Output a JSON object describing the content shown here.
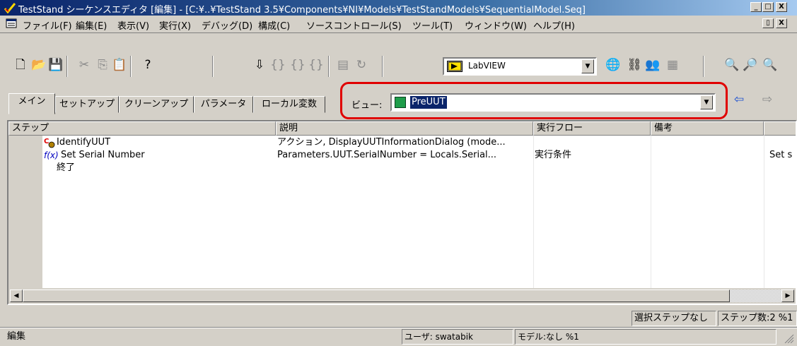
{
  "window": {
    "title": "TestStand シーケンスエディタ [編集] - [C:¥..¥TestStand 3.5¥Components¥NI¥Models¥TestStandModels¥SequentialModel.Seq]",
    "minimize": "_",
    "maximize": "□",
    "close": "X",
    "child_restore": "▯",
    "child_close": "X"
  },
  "menu": {
    "items": [
      "ファイル(F)",
      "編集(E)",
      "表示(V)",
      "実行(X)",
      "デバッグ(D)",
      "構成(C)",
      "ソースコントロール(S)",
      "ツール(T)",
      "ウィンドウ(W)",
      "ヘルプ(H)"
    ]
  },
  "toolbar": {
    "adapter_label": "LabVIEW",
    "adapter_dropdown": "▼"
  },
  "tabs": {
    "items": [
      "メイン",
      "セットアップ",
      "クリーンアップ",
      "パラメータ",
      "ローカル変数"
    ]
  },
  "view": {
    "label": "ビュー:",
    "value": "PreUUT",
    "dropdown": "▼"
  },
  "grid": {
    "columns": [
      "ステップ",
      "説明",
      "実行フロー",
      "備考"
    ],
    "rows": [
      {
        "step": "IdentifyUUT",
        "description": "アクション, DisplayUUTInformationDialog (mode...",
        "flow": "",
        "note": "",
        "extra": ""
      },
      {
        "step": "Set Serial Number",
        "description": "Parameters.UUT.SerialNumber = Locals.Serial...",
        "flow": "実行条件",
        "note": "",
        "extra": "Set s"
      },
      {
        "step": "終了",
        "description": "",
        "flow": "",
        "note": "",
        "extra": ""
      }
    ],
    "scroll_left": "◀",
    "scroll_right": "▶"
  },
  "status": {
    "selection": "選択ステップなし",
    "step_count": "ステップ数:2 %1",
    "mode": "編集",
    "user": "ユーザ: swatabik",
    "model": "モデル:なし %1"
  }
}
